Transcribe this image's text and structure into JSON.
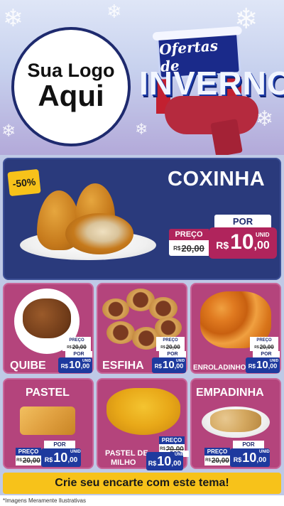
{
  "header": {
    "logo_line1": "Sua Logo",
    "logo_line2": "Aqui",
    "promo_line1": "Ofertas de",
    "promo_line2": "INVERNO"
  },
  "featured": {
    "discount": "-50%",
    "name": "COXINHA",
    "preco_label": "PREÇO",
    "old_currency": "R$",
    "old_price": "20,00",
    "por_label": "POR",
    "currency": "R$",
    "price_int": "10",
    "price_dec": ",00",
    "unit": "UNID"
  },
  "products": [
    {
      "name": "QUIBE",
      "preco_label": "PREÇO",
      "old_currency": "R$",
      "old_price": "20,00",
      "por_label": "POR",
      "currency": "R$",
      "price_int": "10",
      "price_dec": ",00",
      "unit": "UNID"
    },
    {
      "name": "ESFIHA",
      "preco_label": "PREÇO",
      "old_currency": "R$",
      "old_price": "20,00",
      "por_label": "POR",
      "currency": "R$",
      "price_int": "10",
      "price_dec": ",00",
      "unit": "UNID"
    },
    {
      "name": "ENROLADINHO",
      "preco_label": "PREÇO",
      "old_currency": "R$",
      "old_price": "20,00",
      "por_label": "POR",
      "currency": "R$",
      "price_int": "10",
      "price_dec": ",00",
      "unit": "UNID"
    },
    {
      "name": "PASTEL",
      "preco_label": "PREÇO",
      "old_currency": "R$",
      "old_price": "20,00",
      "por_label": "POR",
      "currency": "R$",
      "price_int": "10",
      "price_dec": ",00",
      "unit": "UNID"
    },
    {
      "name_line1": "PASTEL DE",
      "name_line2": "MILHO",
      "preco_label": "PREÇO",
      "old_currency": "R$",
      "old_price": "20,00",
      "por_label": "POR",
      "currency": "R$",
      "price_int": "10",
      "price_dec": ",00",
      "unit": "UNID"
    },
    {
      "name": "EMPADINHA",
      "preco_label": "PREÇO",
      "old_currency": "R$",
      "old_price": "20,00",
      "por_label": "POR",
      "currency": "R$",
      "price_int": "10",
      "price_dec": ",00",
      "unit": "UNID"
    }
  ],
  "footer": {
    "cta": "Crie seu encarte com este tema!",
    "disclaimer": "*Imagens Meramente Ilustrativas"
  },
  "colors": {
    "navy_panel": "#2a3a7c",
    "pink_card": "#b4447c",
    "magenta_price": "#b0245c",
    "blue_price": "#1e3a9e",
    "yellow": "#f7c21a"
  }
}
